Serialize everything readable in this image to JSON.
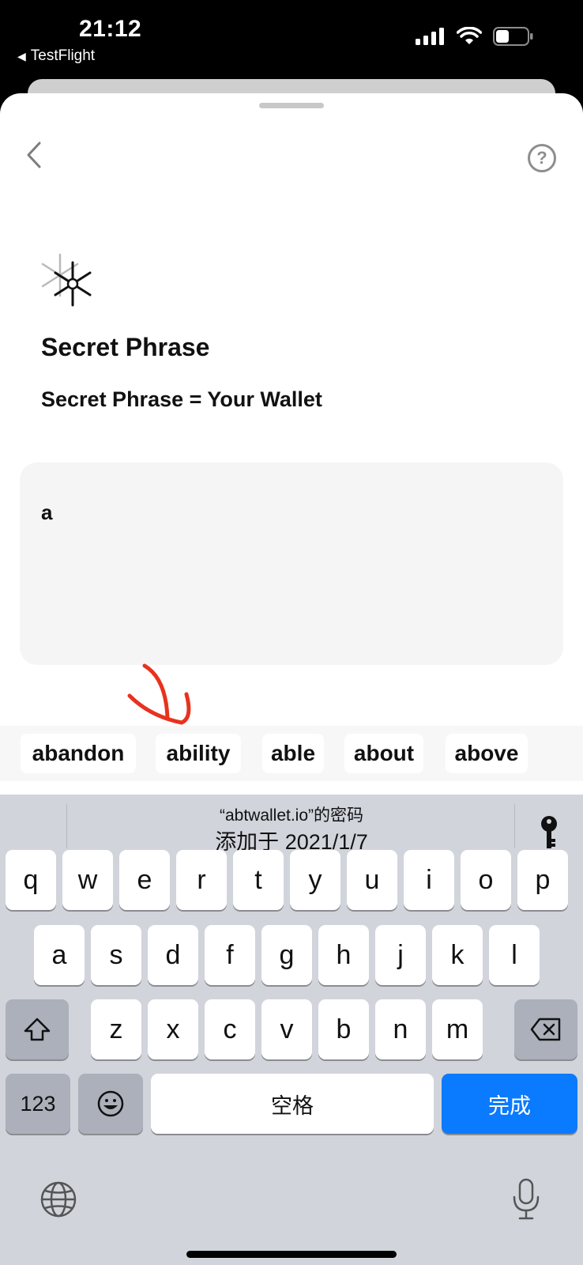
{
  "status": {
    "time": "21:12",
    "back_app": "TestFlight"
  },
  "page": {
    "title": "Secret Phrase",
    "subtitle": "Secret Phrase = Your Wallet",
    "phrase_value": "a"
  },
  "suggestions": [
    "abandon",
    "ability",
    "able",
    "about",
    "above"
  ],
  "keyboard": {
    "password_line1": "“abtwallet.io”的密码",
    "password_line2": "添加于 2021/1/7",
    "row1": [
      "q",
      "w",
      "e",
      "r",
      "t",
      "y",
      "u",
      "i",
      "o",
      "p"
    ],
    "row2": [
      "a",
      "s",
      "d",
      "f",
      "g",
      "h",
      "j",
      "k",
      "l"
    ],
    "row3": [
      "z",
      "x",
      "c",
      "v",
      "b",
      "n",
      "m"
    ],
    "numbers_key": "123",
    "space_key": "空格",
    "done_key": "完成"
  },
  "colors": {
    "accent": "#0a7aff",
    "arrow": "#e8321e",
    "keyboard_bg": "#d1d4db"
  },
  "icons": [
    "back-arrow-icon",
    "signal-icon",
    "wifi-icon",
    "battery-icon",
    "chevron-left-icon",
    "help-icon",
    "snowflake-logo-icon",
    "key-icon",
    "shift-icon",
    "delete-icon",
    "emoji-icon",
    "globe-icon",
    "mic-icon"
  ]
}
